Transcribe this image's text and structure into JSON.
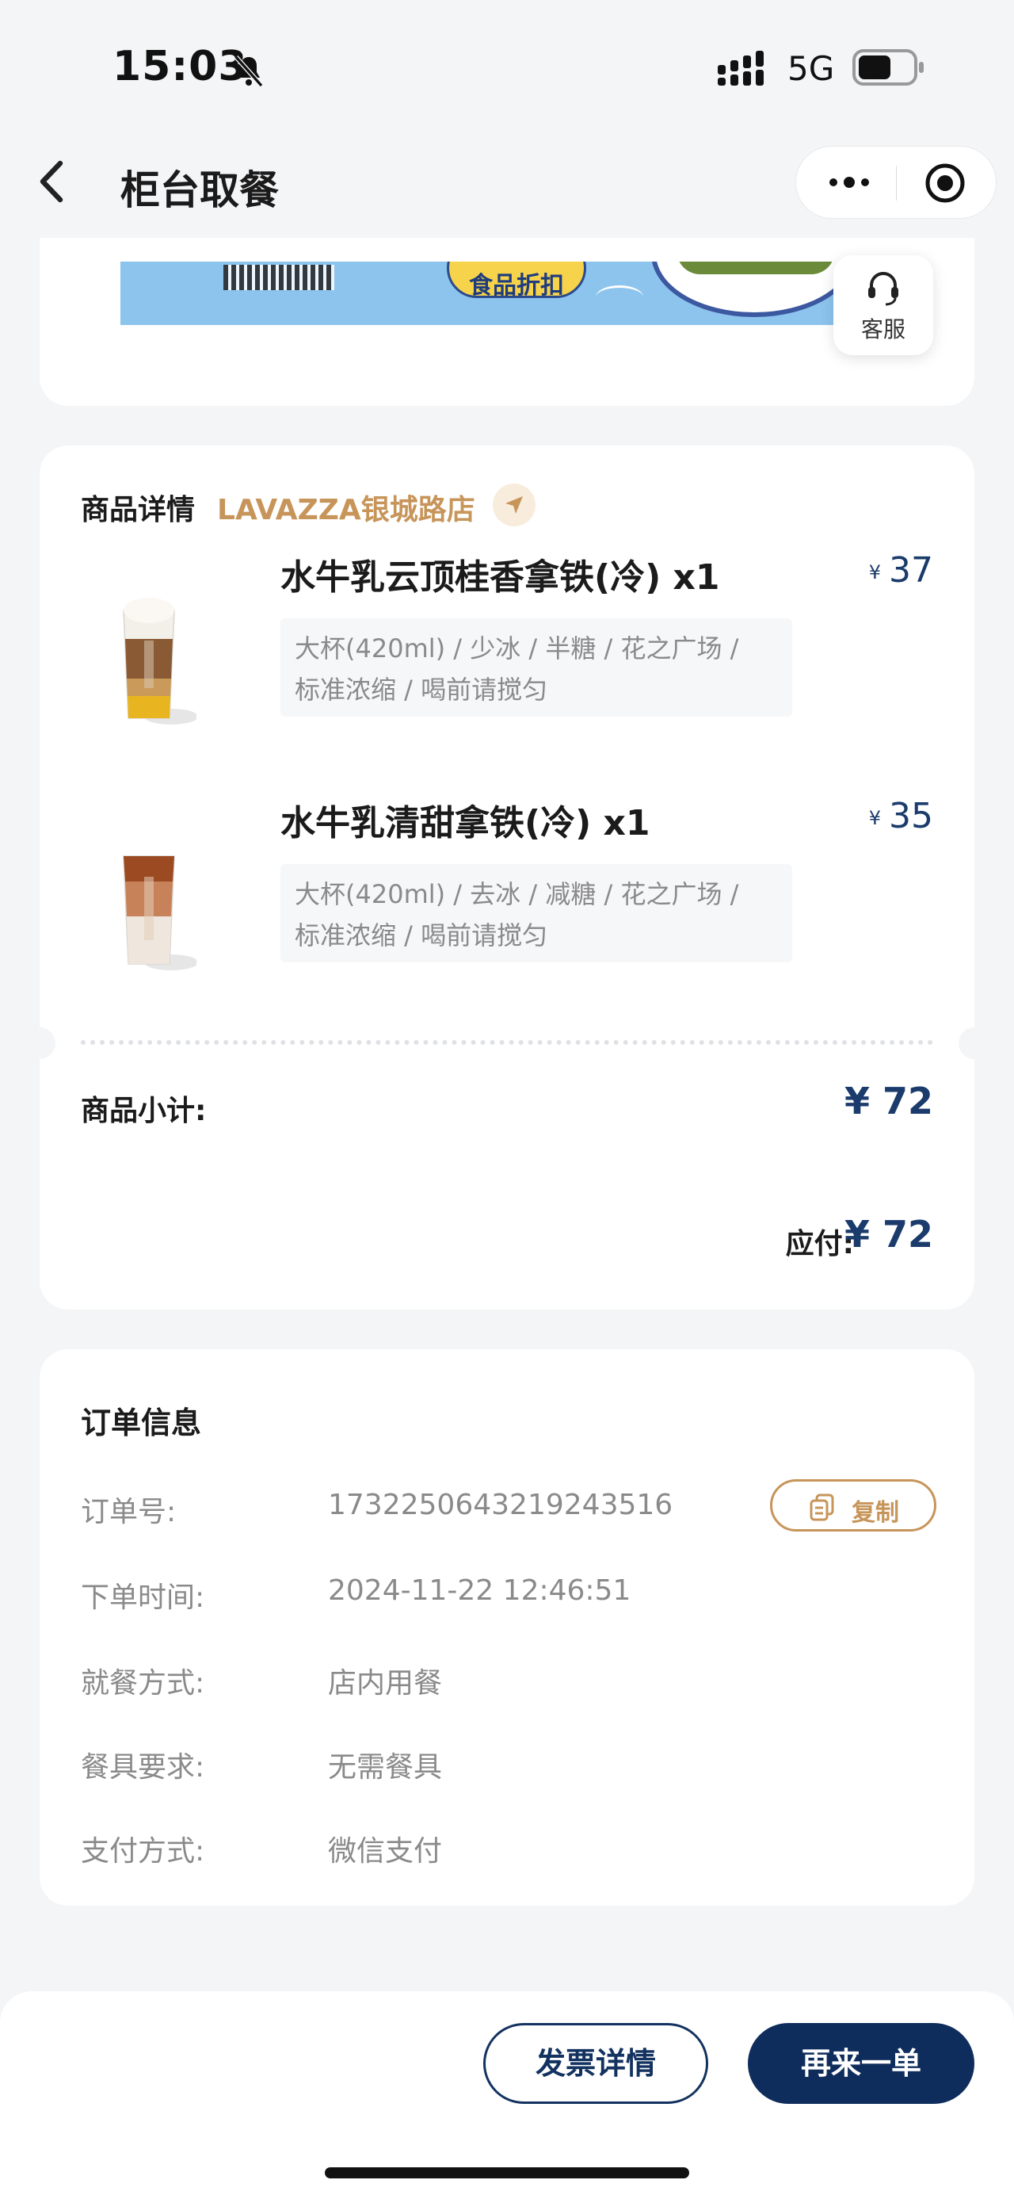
{
  "status_bar": {
    "time": "15:03",
    "network": "5G",
    "icons": [
      "bell-off-icon",
      "signal-icon",
      "battery-icon"
    ]
  },
  "nav": {
    "title": "柜台取餐",
    "icons": [
      "back-arrow-icon",
      "more-dots-icon",
      "close-target-icon"
    ]
  },
  "banner": {
    "badge_text": "食品折扣"
  },
  "customer_service": {
    "label": "客服",
    "icon": "headset-icon"
  },
  "product_card": {
    "header": "商品详情",
    "store_name": "LAVAZZA银城路店",
    "items": [
      {
        "name": "水牛乳云顶桂香拿铁(冷)",
        "qty": "x1",
        "currency": "¥",
        "price": "37",
        "spec_line1": "大杯(420ml) / 少冰 / 半糖 / 花之广场 /",
        "spec_line2": "标准浓缩 / 喝前请搅匀"
      },
      {
        "name": "水牛乳清甜拿铁(冷)",
        "qty": "x1",
        "currency": "¥",
        "price": "35",
        "spec_line1": "大杯(420ml) / 去冰 / 减糖 / 花之广场 /",
        "spec_line2": "标准浓缩 / 喝前请搅匀"
      }
    ],
    "subtotal_label": "商品小计:",
    "subtotal_value": "¥ 72",
    "payable_label": "应付:",
    "payable_value": "¥ 72"
  },
  "order_info": {
    "header": "订单信息",
    "order_no_label": "订单号:",
    "order_no": "1732250643219243516",
    "copy_label": "复制",
    "time_label": "下单时间:",
    "time_value": "2024-11-22 12:46:51",
    "dining_label": "就餐方式:",
    "dining_value": "店内用餐",
    "cutlery_label": "餐具要求:",
    "cutlery_value": "无需餐具",
    "payment_label": "支付方式:",
    "payment_value": "微信支付"
  },
  "bottom_bar": {
    "invoice_label": "发票详情",
    "reorder_label": "再来一单"
  },
  "colors": {
    "accent_gold": "#c7955a",
    "navy": "#0f2d5c",
    "price_blue": "#1a3b6b",
    "background": "#f4f5f7"
  }
}
